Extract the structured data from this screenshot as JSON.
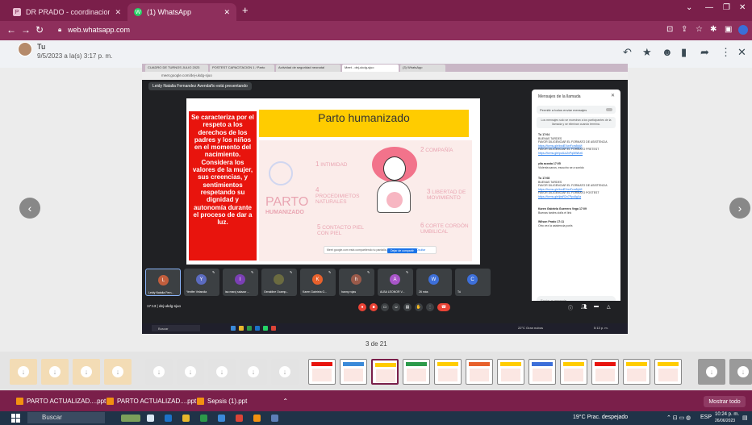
{
  "browser": {
    "tabs": [
      {
        "label": "DR PRADO - coordinacionmedic",
        "favicon": "P"
      },
      {
        "label": "(1) WhatsApp",
        "favicon": "W"
      }
    ],
    "url": "web.whatsapp.com"
  },
  "viewer": {
    "sender": "Tu",
    "timestamp": "9/5/2023 a la(s) 3:17 p. m.",
    "counter": "3 de 21"
  },
  "inner": {
    "tabs": [
      "CUADRO DE TURNOS JULIO 2023",
      "POSTEST CAPACITACION 1 / Parto",
      "Actividad de seguridad neonatal",
      "Meet - dej-ukdg-sjuo",
      "(3) WhatsApp"
    ],
    "url": "meet.google.com/dej-ukdg-sjuo",
    "presenter": "Leidy Natalia Fernandez Avendaño está presentando",
    "snackbar": {
      "text": "Meet google.com está compartiendo tu pantalla.",
      "stop": "Dejar de compartir",
      "hide": "Ocultar"
    },
    "meeting_time": "17:13",
    "meeting_code": "dej-ukdg-sjuo",
    "taskbar_search": "Buscar",
    "taskbar_weather": "22°C Gran nubos",
    "taskbar_time": "5:13 p. m."
  },
  "slide": {
    "title": "Parto humanizado",
    "red_text": "Se caracteriza por el respeto a los derechos de los padres y los niños en el momento del nacimiento. Considera los valores de la mujer, sus creencias, y sentimientos respetando su dignidad y autonomía durante el proceso de dar a luz.",
    "infographic": {
      "heading": "PARTO",
      "subheading": "HUMANIZADO",
      "items": [
        {
          "num": "1",
          "label": "INTIMIDAD"
        },
        {
          "num": "2",
          "label": "COMPAÑÍA"
        },
        {
          "num": "3",
          "label": "LIBERTAD DE MOVIMIENTO"
        },
        {
          "num": "4",
          "label": "PROCEDIMIETOS NATURALES"
        },
        {
          "num": "5",
          "label": "CONTACTO PIEL CON PIEL"
        },
        {
          "num": "6",
          "label": "CORTE CORDÓN UMBILICAL"
        }
      ]
    }
  },
  "chat": {
    "title": "Mensajes de la llamada",
    "permission": "Permitir a todos enviar mensajes",
    "notice": "Los mensajes solo se muestran a los participantes de la llamada y se eliminan cuando termina.",
    "messages": [
      {
        "who": "Tú 17:04",
        "lines": [
          "BUENAS TARDES",
          "FAVOR DILIGENCIAR EL FORMATO DE ASISTENCIA"
        ],
        "link": "https://forms.gle/bxdEVwrFcm8yWi",
        "lines2": [
          "FAVOR DILIGENCIAR EL FORMATO PRETEST"
        ],
        "link2": "https://forms.gle/pc4Lk2xPqMWbz6"
      },
      {
        "who": "yila acosta 17:05",
        "lines": [
          "Violenta sanos, escucho se a sonido"
        ]
      },
      {
        "who": "Tú 17:08",
        "lines": [
          "BUENAS TARDES",
          "FAVOR DILIGENCIAR EL FORMATO DE ASISTENCIA"
        ],
        "link": "https://forms.gle/bxdEVwrFcm8yWi",
        "lines2": [
          "FAVOR DILIGENCIAR EL FORMATO POSTEST"
        ],
        "link2": "https://forms.gle/jbsR2n7Ppo8gXa"
      },
      {
        "who": "Karen Gabriela Guerrero Vega 17:09",
        "lines": [
          "Buenas tardes doña el link"
        ]
      },
      {
        "who": "Wilson Prado 17:11",
        "lines": [
          "Otro vez la asistencia porfa"
        ]
      }
    ],
    "send_placeholder": "Envía un mensaje"
  },
  "participants": [
    {
      "initial": "L",
      "name": "Leidy Natalia Fern...",
      "color": "#c25e3d"
    },
    {
      "initial": "Y",
      "name": "Yenifer Velandia",
      "color": "#5b6bc0"
    },
    {
      "initial": "I",
      "name": "isa marcj salazar ...",
      "color": "#7b3fb5"
    },
    {
      "initial": "",
      "name": "Geraldine Ocamp...",
      "color": "#6b6b40"
    },
    {
      "initial": "K",
      "name": "Karen Gabriela G...",
      "color": "#e8612c"
    },
    {
      "initial": "h",
      "name": "hanny rojas",
      "color": "#9a5a4a"
    },
    {
      "initial": "A",
      "name": "ALBA LEONOR V...",
      "color": "#a855c8"
    },
    {
      "initial": "W",
      "name": "26 más",
      "color": "#3d6fd9"
    },
    {
      "initial": "C",
      "name": "Tú",
      "color": "#3d6fd9"
    }
  ],
  "downloads": [
    {
      "label": "PARTO ACTUALIZAD....ppt"
    },
    {
      "label": "PARTO ACTUALIZAD....ppt"
    },
    {
      "label": "Sepsis (1).ppt"
    }
  ],
  "show_all": "Mostrar todo",
  "taskbar": {
    "search": "Buscar",
    "weather": "19°C  Prac. despejado",
    "lang": "ESP",
    "time": "10:24 p. m.",
    "date": "26/06/2023"
  },
  "colors": {
    "chrome_theme": "#7a1f4a",
    "slide_red": "#e8140d",
    "slide_yellow": "#ffcc00",
    "meet_dark": "#202124",
    "taskbar": "#203348"
  }
}
